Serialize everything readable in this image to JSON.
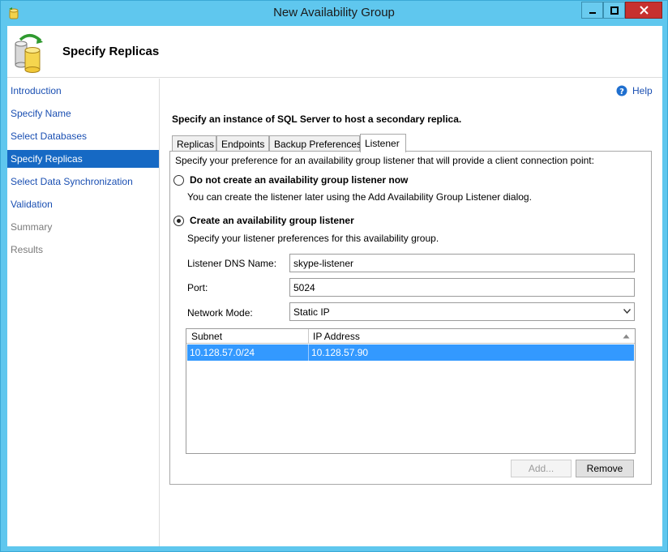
{
  "window": {
    "title": "New Availability Group"
  },
  "header": {
    "title": "Specify Replicas"
  },
  "nav": {
    "items": [
      {
        "label": "Introduction",
        "state": "link"
      },
      {
        "label": "Specify Name",
        "state": "link"
      },
      {
        "label": "Select Databases",
        "state": "link"
      },
      {
        "label": "Specify Replicas",
        "state": "active"
      },
      {
        "label": "Select Data Synchronization",
        "state": "link"
      },
      {
        "label": "Validation",
        "state": "link"
      },
      {
        "label": "Summary",
        "state": "disabled"
      },
      {
        "label": "Results",
        "state": "disabled"
      }
    ]
  },
  "main": {
    "help_label": "Help",
    "instruction": "Specify an instance of SQL Server to host a secondary replica.",
    "tabs": [
      {
        "label": "Replicas"
      },
      {
        "label": "Endpoints"
      },
      {
        "label": "Backup Preferences"
      },
      {
        "label": "Listener",
        "active": true
      }
    ],
    "listener": {
      "description": "Specify your preference for an availability group listener that will provide a client connection point:",
      "option_none": {
        "label": "Do not create an availability group listener now",
        "sub": "You can create the listener later using the Add Availability Group Listener dialog.",
        "checked": false
      },
      "option_create": {
        "label": "Create an availability group listener",
        "sub": "Specify your listener preferences for this availability group.",
        "checked": true
      },
      "dns_label": "Listener DNS Name:",
      "dns_value": "skype-listener",
      "port_label": "Port:",
      "port_value": "5024",
      "network_label": "Network Mode:",
      "network_value": "Static IP",
      "grid": {
        "columns": [
          "Subnet",
          "IP Address"
        ],
        "rows": [
          {
            "subnet": "10.128.57.0/24",
            "ip": "10.128.57.90",
            "selected": true
          }
        ]
      },
      "add_label": "Add...",
      "remove_label": "Remove"
    }
  },
  "colors": {
    "titlebar": "#5fc7ee",
    "nav_active": "#1669c4",
    "link": "#1a4fb2",
    "selected_row": "#3399ff",
    "close_button": "#c7312f"
  }
}
